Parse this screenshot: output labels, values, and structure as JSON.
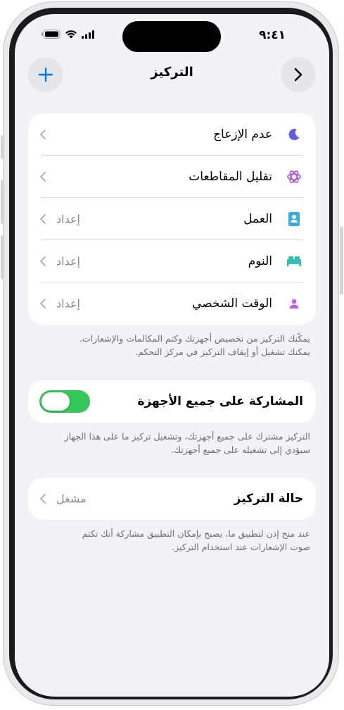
{
  "status_bar": {
    "time": "٩:٤١"
  },
  "nav": {
    "title": "التركيز"
  },
  "focus_modes": [
    {
      "label": "عدم الإزعاج",
      "value": "",
      "icon": "moon-icon",
      "color": "#5e5ce6"
    },
    {
      "label": "تقليل المقاطعات",
      "value": "",
      "icon": "reduce-interruptions-icon",
      "color": "#af52de"
    },
    {
      "label": "العمل",
      "value": "إعداد",
      "icon": "work-badge-icon",
      "color": "#32ade6"
    },
    {
      "label": "النوم",
      "value": "إعداد",
      "icon": "bed-icon",
      "color": "#30c0b0"
    },
    {
      "label": "الوقت الشخصي",
      "value": "إعداد",
      "icon": "person-icon",
      "color": "#bf5af2"
    }
  ],
  "focus_footnote": {
    "line1": "يمكّنك التركيز من تخصيص أجهزتك وكتم المكالمات والإشعارات.",
    "line2": "يمكنك تشغيل أو إيقاف التركيز في مركز التحكم."
  },
  "share_across_devices": {
    "label": "المشاركة على جميع الأجهزة",
    "on": true,
    "footnote_line1": "التركيز مشترك على جميع أجهزتك، وتشغيل تركيز ما على هذا الجهاز",
    "footnote_line2": "سيؤدي إلى تشغيله على جميع أجهزتك."
  },
  "focus_status": {
    "label": "حالة التركيز",
    "value": "مشغل",
    "footnote_line1": "عند منح إذن لتطبيق ما، يصبح بإمكان التطبيق مشاركة أنك تكتم",
    "footnote_line2": "صوت الإشعارات عند استخدام التركيز."
  },
  "colors": {
    "accent": "#007aff",
    "toggle_on": "#34c759"
  }
}
